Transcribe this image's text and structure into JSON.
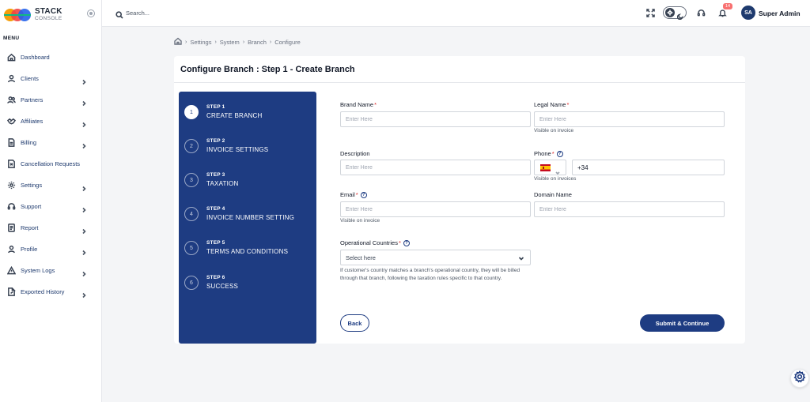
{
  "brand": {
    "name": "STACK",
    "subtitle": "CONSOLE"
  },
  "sidebar": {
    "menu_label": "MENU",
    "items": [
      {
        "label": "Dashboard",
        "icon": "home-icon",
        "has_submenu": false
      },
      {
        "label": "Clients",
        "icon": "user-icon",
        "has_submenu": true
      },
      {
        "label": "Partners",
        "icon": "users-icon",
        "has_submenu": true
      },
      {
        "label": "Affiliates",
        "icon": "handshake-icon",
        "has_submenu": true
      },
      {
        "label": "Billing",
        "icon": "document-icon",
        "has_submenu": true
      },
      {
        "label": "Cancellation Requests",
        "icon": "cancel-document-icon",
        "has_submenu": false
      },
      {
        "label": "Settings",
        "icon": "gear-icon",
        "has_submenu": true
      },
      {
        "label": "Support",
        "icon": "headset-icon",
        "has_submenu": true
      },
      {
        "label": "Report",
        "icon": "report-icon",
        "has_submenu": true
      },
      {
        "label": "Profile",
        "icon": "profile-icon",
        "has_submenu": true
      },
      {
        "label": "System Logs",
        "icon": "warning-icon",
        "has_submenu": true
      },
      {
        "label": "Exported History",
        "icon": "export-icon",
        "has_submenu": true
      }
    ]
  },
  "topbar": {
    "search_placeholder": "Search...",
    "notification_count": "14",
    "user": {
      "initials": "SA",
      "name": "Super Admin"
    }
  },
  "breadcrumb": [
    "Settings",
    "System",
    "Branch",
    "Configure"
  ],
  "page": {
    "title": "Configure Branch : Step 1 - Create Branch"
  },
  "steps": [
    {
      "number": "1",
      "step_label": "STEP 1",
      "title": "CREATE BRANCH",
      "active": true
    },
    {
      "number": "2",
      "step_label": "STEP 2",
      "title": "INVOICE SETTINGS",
      "active": false
    },
    {
      "number": "3",
      "step_label": "STEP 3",
      "title": "TAXATION",
      "active": false
    },
    {
      "number": "4",
      "step_label": "STEP 4",
      "title": "INVOICE NUMBER SETTING",
      "active": false
    },
    {
      "number": "5",
      "step_label": "STEP 5",
      "title": "TERMS AND CONDITIONS",
      "active": false
    },
    {
      "number": "6",
      "step_label": "STEP 6",
      "title": "SUCCESS",
      "active": false
    }
  ],
  "form": {
    "brand_name": {
      "label": "Brand Name",
      "required": "*",
      "placeholder": "Enter Here"
    },
    "legal_name": {
      "label": "Legal Name",
      "required": "*",
      "placeholder": "Enter Here",
      "hint": "Visible on invoice"
    },
    "description": {
      "label": "Description",
      "placeholder": "Enter Here"
    },
    "phone": {
      "label": "Phone",
      "required": "*",
      "help": "?",
      "country": "Spain",
      "value": "+34",
      "hint": "Visible on invoices"
    },
    "email": {
      "label": "Email",
      "required": "*",
      "help": "?",
      "placeholder": "Enter Here",
      "hint": "Visible on invoice"
    },
    "domain_name": {
      "label": "Domain Name",
      "placeholder": "Enter Here"
    },
    "operational_countries": {
      "label": "Operational Countries",
      "required": "*",
      "help": "?",
      "placeholder": "Select here",
      "note": "If customer's country matches a branch's operational country, they will be billed through that branch, following the taxation rules specific to that country."
    },
    "back_label": "Back",
    "submit_label": "Submit & Continue"
  },
  "colors": {
    "primary": "#1e3c82",
    "required": "#dc2626",
    "badge": "#f87171"
  }
}
